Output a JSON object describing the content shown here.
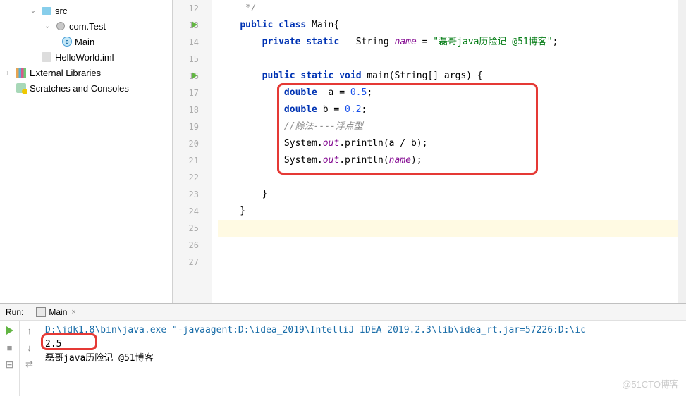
{
  "tree": {
    "src": "src",
    "package": "com.Test",
    "main_class": "Main",
    "iml_file": "HelloWorld.iml",
    "external_libs": "External Libraries",
    "scratches": "Scratches and Consoles"
  },
  "editor": {
    "line_start": 12,
    "line_end": 27,
    "lines": {
      "l12": "     */",
      "l13_kw1": "public",
      "l13_kw2": "class",
      "l13_name": " Main{",
      "l14_kw1": "private",
      "l14_kw2": "static",
      "l14_type": "   String ",
      "l14_field": "name",
      "l14_eq": " = ",
      "l14_str": "\"磊哥java历险记 @51博客\"",
      "l14_semi": ";",
      "l16_kw1": "public",
      "l16_kw2": "static",
      "l16_kw3": "void",
      "l16_method": " main(String[] args) {",
      "l17_kw": "double",
      "l17_rest": "  a = ",
      "l17_num": "0.5",
      "l17_semi": ";",
      "l18_kw": "double",
      "l18_rest": " b = ",
      "l18_num": "0.2",
      "l18_semi": ";",
      "l19_comment": "//除法----浮点型",
      "l20_sys": "System.",
      "l20_out": "out",
      "l20_call": ".println(a / b);",
      "l21_sys": "System.",
      "l21_out": "out",
      "l21_call": ".println(",
      "l21_field": "name",
      "l21_end": ");",
      "l23": "        }",
      "l24": "    }"
    }
  },
  "run": {
    "panel_label": "Run:",
    "tab_name": "Main",
    "console": {
      "cmd": "D:\\jdk1.8\\bin\\java.exe \"-javaagent:D:\\idea_2019\\IntelliJ IDEA 2019.2.3\\lib\\idea_rt.jar=57226:D:\\ic",
      "out1": "2.5",
      "out2": "磊哥java历险记 @51博客"
    }
  },
  "watermark": "@51CTO博客",
  "chart_data": null
}
